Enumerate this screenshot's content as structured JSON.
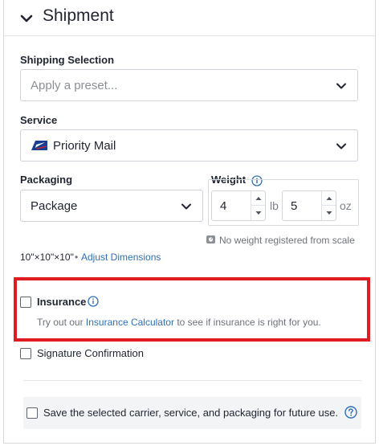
{
  "header": {
    "title": "Shipment"
  },
  "shipping_selection": {
    "label": "Shipping Selection",
    "placeholder": "Apply a preset..."
  },
  "service": {
    "label": "Service",
    "value": "Priority Mail"
  },
  "packaging": {
    "label": "Packaging",
    "value": "Package",
    "dimensions": "10\"×10\"×10\"",
    "separator": "•",
    "adjust_link": "Adjust Dimensions"
  },
  "weight": {
    "label": "Weight",
    "pounds": "4",
    "pounds_unit": "lb",
    "ounces": "5",
    "ounces_unit": "oz",
    "scale_note": "No weight registered from scale"
  },
  "insurance": {
    "label": "Insurance",
    "checked": false,
    "hint_prefix": "Try out our",
    "hint_link": "Insurance Calculator",
    "hint_suffix": "to see if insurance is right for you."
  },
  "signature": {
    "label": "Signature Confirmation",
    "checked": false
  },
  "save_defaults": {
    "label": "Save the selected carrier, service, and packaging for future use.",
    "checked": false
  },
  "colors": {
    "accent": "#2f6fb8",
    "highlight": "#e01b22"
  }
}
